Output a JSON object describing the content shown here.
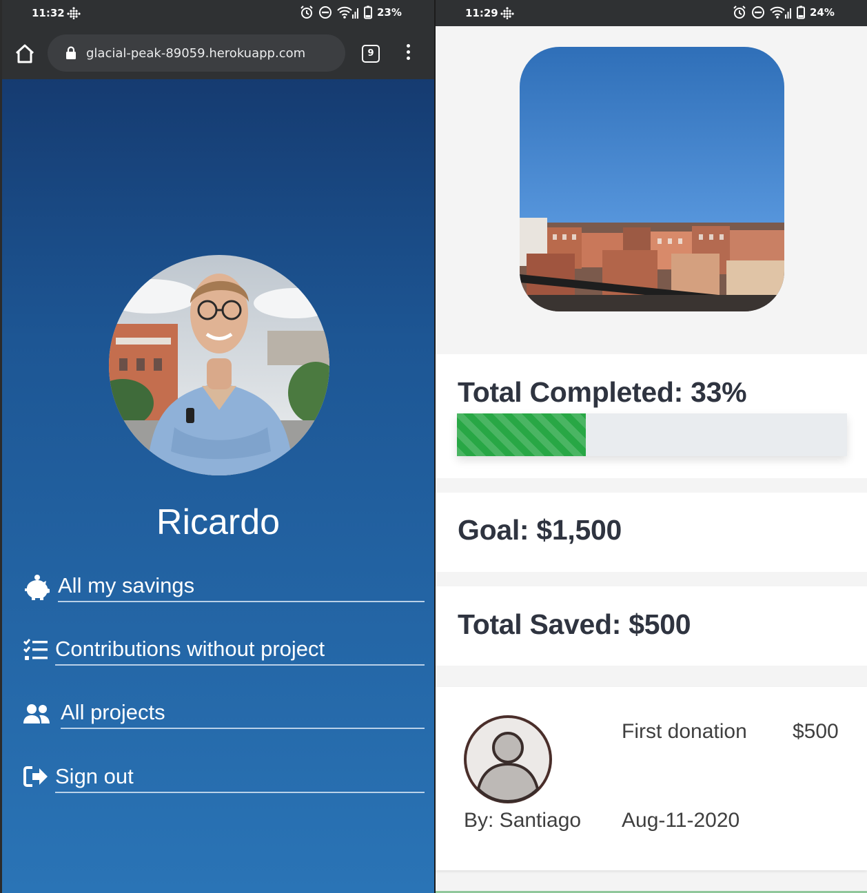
{
  "left_phone": {
    "status_bar": {
      "time": "11:32",
      "battery": "23%"
    },
    "browser": {
      "url": "glacial-peak-89059.herokuapp.com",
      "tab_count": "9"
    },
    "profile": {
      "name": "Ricardo"
    },
    "menu": [
      {
        "label": "All my savings",
        "icon": "piggy-bank-icon"
      },
      {
        "label": "Contributions without project",
        "icon": "tasks-list-icon"
      },
      {
        "label": "All projects",
        "icon": "users-icon"
      },
      {
        "label": "Sign out",
        "icon": "sign-out-icon"
      }
    ]
  },
  "right_phone": {
    "status_bar": {
      "time": "11:29",
      "battery": "24%"
    },
    "project": {
      "completed_label": "Total Completed: 33%",
      "completed_fraction": 0.33,
      "goal_label": "Goal: $1,500",
      "saved_label": "Total Saved: $500"
    },
    "donation": {
      "title": "First donation",
      "amount": "$500",
      "donor": "By: Santiago",
      "date": "Aug-11-2020"
    }
  },
  "colors": {
    "progress_fill": "#28a745",
    "gradient_top": "#133366",
    "gradient_bottom": "#2a74b6",
    "heading_text": "#2f3440"
  }
}
